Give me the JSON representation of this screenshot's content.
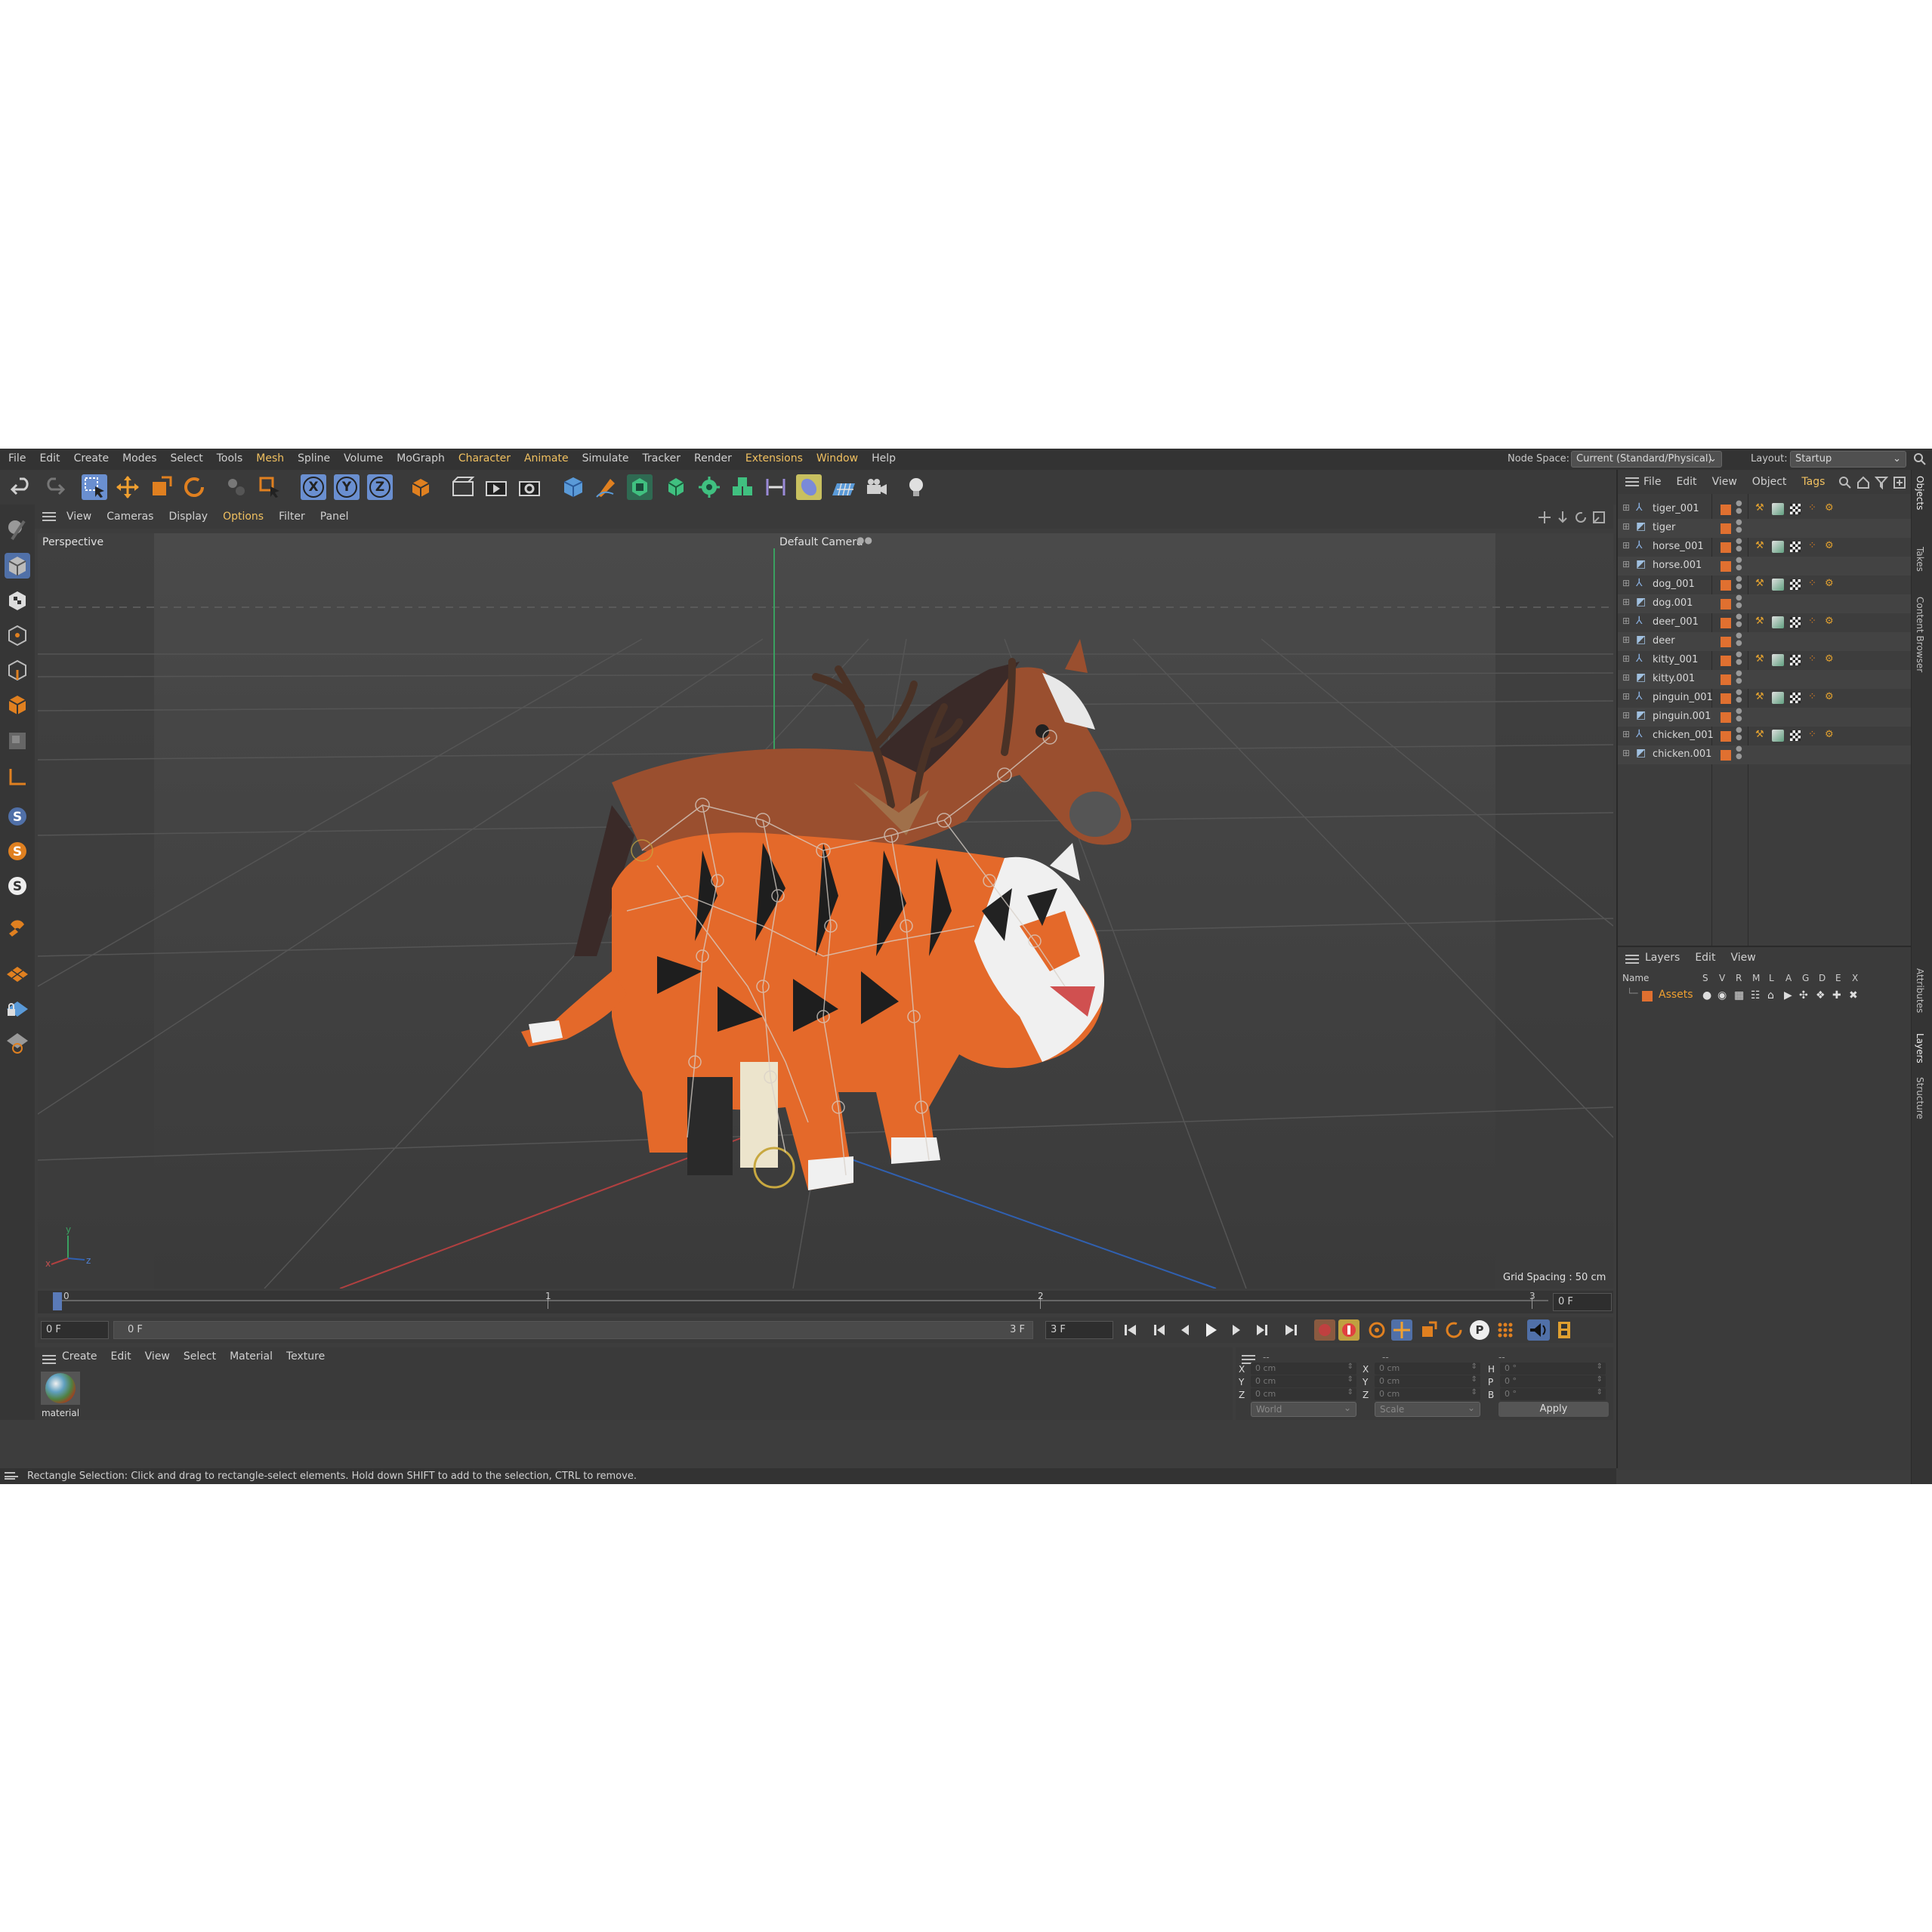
{
  "menubar": {
    "items": [
      "File",
      "Edit",
      "Create",
      "Modes",
      "Select",
      "Tools",
      "Mesh",
      "Spline",
      "Volume",
      "MoGraph",
      "Character",
      "Animate",
      "Simulate",
      "Tracker",
      "Render",
      "Extensions",
      "Window",
      "Help"
    ],
    "highlighted": [
      "Mesh",
      "Character",
      "Animate",
      "Extensions",
      "Window"
    ],
    "node_space_label": "Node Space:",
    "node_space_value": "Current (Standard/Physical)",
    "layout_label": "Layout:",
    "layout_value": "Startup"
  },
  "toolbar": {
    "axis_x": "X",
    "axis_y": "Y",
    "axis_z": "Z"
  },
  "viewport_menu": [
    "View",
    "Cameras",
    "Display",
    "Options",
    "Filter",
    "Panel"
  ],
  "viewport": {
    "view_name": "Perspective",
    "camera": "Default Camera",
    "grid_spacing": "Grid Spacing : 50 cm",
    "axis_labels": {
      "x": "x",
      "y": "y",
      "z": "z"
    }
  },
  "timeline": {
    "ticks": [
      "0",
      "1",
      "2",
      "3"
    ],
    "current_frame_right": "0 F"
  },
  "transport": {
    "start_field": "0 F",
    "range_start": "0 F",
    "range_end": "3 F",
    "end_field": "3 F",
    "badge_p": "P"
  },
  "material_manager": {
    "menu": [
      "Create",
      "Edit",
      "View",
      "Select",
      "Material",
      "Texture"
    ],
    "materials": [
      {
        "name": "material"
      }
    ]
  },
  "coordinates": {
    "headers": [
      "--",
      "--",
      "--"
    ],
    "rows": [
      {
        "pos_label": "X",
        "pos": "0 cm",
        "size_label": "X",
        "size": "0 cm",
        "rot_label": "H",
        "rot": "0 °"
      },
      {
        "pos_label": "Y",
        "pos": "0 cm",
        "size_label": "Y",
        "size": "0 cm",
        "rot_label": "P",
        "rot": "0 °"
      },
      {
        "pos_label": "Z",
        "pos": "0 cm",
        "size_label": "Z",
        "size": "0 cm",
        "rot_label": "B",
        "rot": "0 °"
      }
    ],
    "space": "World",
    "mode": "Scale",
    "apply": "Apply"
  },
  "status": {
    "text": "Rectangle Selection: Click and drag to rectangle-select elements. Hold down SHIFT to add to the selection, CTRL to remove."
  },
  "object_manager": {
    "menu": [
      "File",
      "Edit",
      "View",
      "Object",
      "Tags"
    ],
    "objects": [
      {
        "name": "tiger_001",
        "kind": "skeleton",
        "tags": true
      },
      {
        "name": "tiger",
        "kind": "mesh",
        "tags": false
      },
      {
        "name": "horse_001",
        "kind": "skeleton",
        "tags": true
      },
      {
        "name": "horse.001",
        "kind": "mesh",
        "tags": false
      },
      {
        "name": "dog_001",
        "kind": "skeleton",
        "tags": true
      },
      {
        "name": "dog.001",
        "kind": "mesh",
        "tags": false
      },
      {
        "name": "deer_001",
        "kind": "skeleton",
        "tags": true
      },
      {
        "name": "deer",
        "kind": "mesh",
        "tags": false
      },
      {
        "name": "kitty_001",
        "kind": "skeleton",
        "tags": true
      },
      {
        "name": "kitty.001",
        "kind": "mesh",
        "tags": false
      },
      {
        "name": "pinguin_001",
        "kind": "skeleton",
        "tags": true
      },
      {
        "name": "pinguin.001",
        "kind": "mesh",
        "tags": false
      },
      {
        "name": "chicken_001",
        "kind": "skeleton",
        "tags": true
      },
      {
        "name": "chicken.001",
        "kind": "mesh",
        "tags": false
      }
    ]
  },
  "layers_manager": {
    "menu": [
      "Layers",
      "Edit",
      "View"
    ],
    "columns": [
      "Name",
      "S",
      "V",
      "R",
      "M",
      "L",
      "A",
      "G",
      "D",
      "E",
      "X"
    ],
    "layers": [
      {
        "name": "Assets"
      }
    ]
  },
  "right_tabs": [
    "Objects",
    "Takes",
    "Content Browser",
    "Attributes",
    "Layers",
    "Structure"
  ],
  "colors": {
    "accent": "#f0c060",
    "orange": "#e07030",
    "blue_tool": "#6a8fd0",
    "bg": "#3d3d3d"
  }
}
